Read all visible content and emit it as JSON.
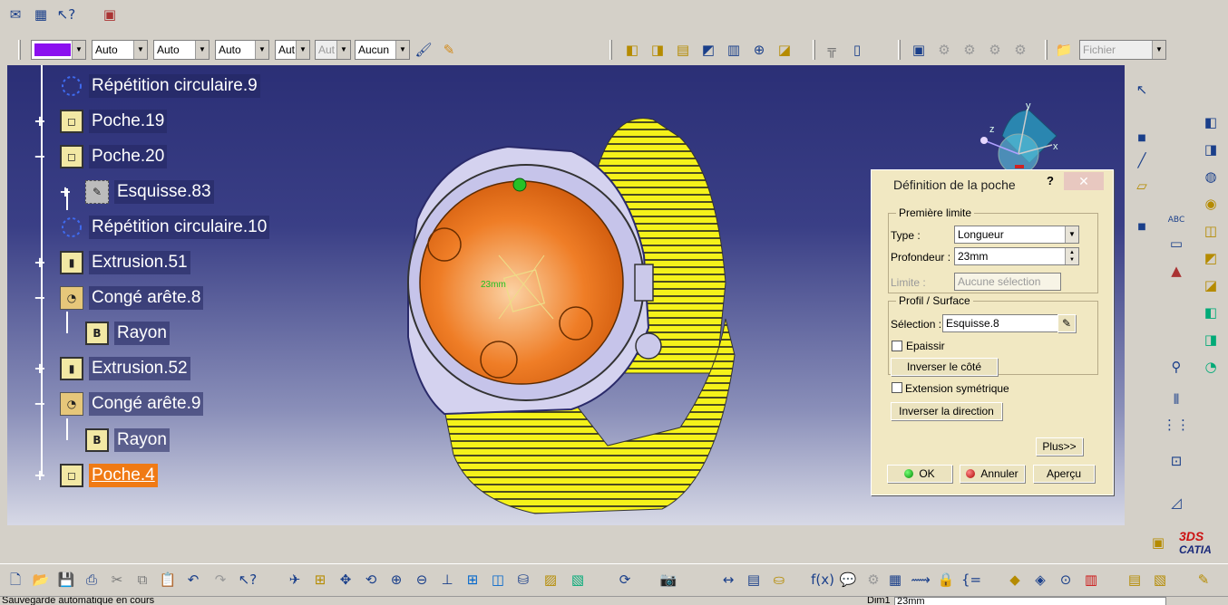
{
  "toolbar_top": {
    "icons": [
      "envelope-icon",
      "tree-structure-icon",
      "help-pointer-icon",
      "product-icon"
    ]
  },
  "properties_toolbar": {
    "color_value": "#8b10ef",
    "line_type": "Auto",
    "thickness": "Auto",
    "point_style": "Auto",
    "layer": "Aut",
    "layer_disabled": "Aut",
    "render": "Aucun",
    "file_select": "Fichier"
  },
  "spec_tree": {
    "items": [
      {
        "label": "Répétition circulaire.9",
        "icon": "circular-pattern-icon",
        "expander": ""
      },
      {
        "label": "Poche.19",
        "icon": "pocket-icon",
        "expander": "+"
      },
      {
        "label": "Poche.20",
        "icon": "pocket-icon",
        "expander": "−"
      },
      {
        "label": "Esquisse.83",
        "icon": "sketch-icon",
        "expander": "+"
      },
      {
        "label": "Répétition circulaire.10",
        "icon": "circular-pattern-icon",
        "expander": ""
      },
      {
        "label": "Extrusion.51",
        "icon": "pad-icon",
        "expander": "+"
      },
      {
        "label": "Congé arête.8",
        "icon": "edge-fillet-icon",
        "expander": "−"
      },
      {
        "label": "Rayon",
        "icon": "radius-icon",
        "expander": ""
      },
      {
        "label": "Extrusion.52",
        "icon": "pad-icon",
        "expander": "+"
      },
      {
        "label": "Congé arête.9",
        "icon": "edge-fillet-icon",
        "expander": "−"
      },
      {
        "label": "Rayon",
        "icon": "radius-icon",
        "expander": ""
      },
      {
        "label": "Poche.4",
        "icon": "pocket-icon",
        "expander": "+"
      }
    ]
  },
  "compass": {
    "x": "x",
    "y": "y",
    "z": "z"
  },
  "dialog": {
    "title": "Définition de la poche",
    "help": "?",
    "close": "✕",
    "first_limit": {
      "legend": "Première limite",
      "type_label": "Type :",
      "type_value": "Longueur",
      "depth_label": "Profondeur :",
      "depth_value": "23mm",
      "limit_label": "Limite :",
      "limit_value": "Aucune sélection"
    },
    "profile": {
      "legend": "Profil / Surface",
      "selection_label": "Sélection :",
      "selection_value": "Esquisse.8",
      "thicken_label": "Epaissir",
      "reverse_side_label": "Inverser le côté"
    },
    "mirror_label": "Extension symétrique",
    "reverse_dir_label": "Inverser la direction",
    "more_label": "Plus>>",
    "ok_label": "OK",
    "cancel_label": "Annuler",
    "preview_label": "Aperçu"
  },
  "catia_logo": "CATIA",
  "status": {
    "message": "Sauvegarde automatique en cours",
    "field_label": "Dim1",
    "field_value": "23mm"
  }
}
